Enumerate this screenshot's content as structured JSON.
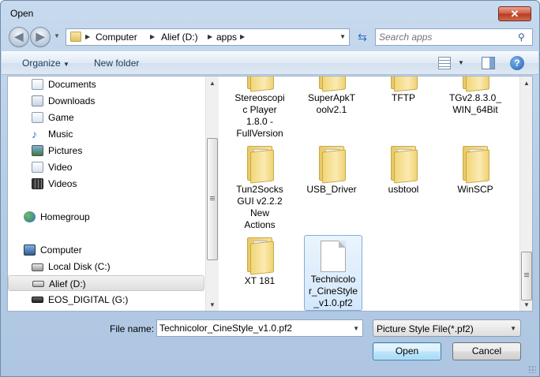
{
  "window": {
    "title": "Open"
  },
  "address": {
    "crumbs": [
      "Computer",
      "Alief (D:)",
      "apps"
    ]
  },
  "search": {
    "placeholder": "Search apps"
  },
  "toolbar": {
    "organize": "Organize",
    "new_folder": "New folder"
  },
  "nav": {
    "items": [
      {
        "label": "Documents",
        "icon": "documents-icon"
      },
      {
        "label": "Downloads",
        "icon": "downloads-icon"
      },
      {
        "label": "Game",
        "icon": "library-icon"
      },
      {
        "label": "Music",
        "icon": "music-icon"
      },
      {
        "label": "Pictures",
        "icon": "pictures-icon"
      },
      {
        "label": "Video",
        "icon": "library-icon"
      },
      {
        "label": "Videos",
        "icon": "videos-icon"
      },
      {
        "label": "Homegroup",
        "icon": "homegroup-icon"
      },
      {
        "label": "Computer",
        "icon": "computer-icon"
      },
      {
        "label": "Local Disk (C:)",
        "icon": "disk-icon"
      },
      {
        "label": "Alief (D:)",
        "icon": "drive-icon",
        "selected": true
      },
      {
        "label": "EOS_DIGITAL (G:)",
        "icon": "drive-icon"
      }
    ]
  },
  "files": [
    {
      "name": "Stereoscopic Player 1.8.0 - FullVersion",
      "lines": [
        "Stereoscopi",
        "c Player",
        "1.8.0 -",
        "FullVersion"
      ],
      "type": "folder"
    },
    {
      "name": "SuperApkToolv2.1",
      "lines": [
        "SuperApkT",
        "oolv2.1"
      ],
      "type": "folder"
    },
    {
      "name": "TFTP",
      "lines": [
        "TFTP"
      ],
      "type": "folder"
    },
    {
      "name": "TGv2.8.3.0_WIN_64Bit",
      "lines": [
        "TGv2.8.3.0_",
        "WIN_64Bit"
      ],
      "type": "folder"
    },
    {
      "name": "Tun2Socks GUI v2.2.2 New Actions",
      "lines": [
        "Tun2Socks",
        "GUI v2.2.2",
        "New",
        "Actions"
      ],
      "type": "folder"
    },
    {
      "name": "USB_Driver",
      "lines": [
        "USB_Driver"
      ],
      "type": "folder"
    },
    {
      "name": "usbtool",
      "lines": [
        "usbtool"
      ],
      "type": "folder"
    },
    {
      "name": "WinSCP",
      "lines": [
        "WinSCP"
      ],
      "type": "folder"
    },
    {
      "name": "XT 181",
      "lines": [
        "XT 181"
      ],
      "type": "folder"
    },
    {
      "name": "Technicolor_CineStyle_v1.0.pf2",
      "lines": [
        "Technicolo",
        "r_CineStyle",
        "_v1.0.pf2"
      ],
      "type": "file",
      "selected": true
    }
  ],
  "footer": {
    "file_name_label": "File name:",
    "file_name_value": "Technicolor_CineStyle_v1.0.pf2",
    "filter": "Picture Style File(*.pf2)",
    "open": "Open",
    "cancel": "Cancel"
  },
  "colors": {
    "selection_blue": "#d3e8fb",
    "close_red": "#c9452b",
    "title_bar": "#c7daee"
  }
}
